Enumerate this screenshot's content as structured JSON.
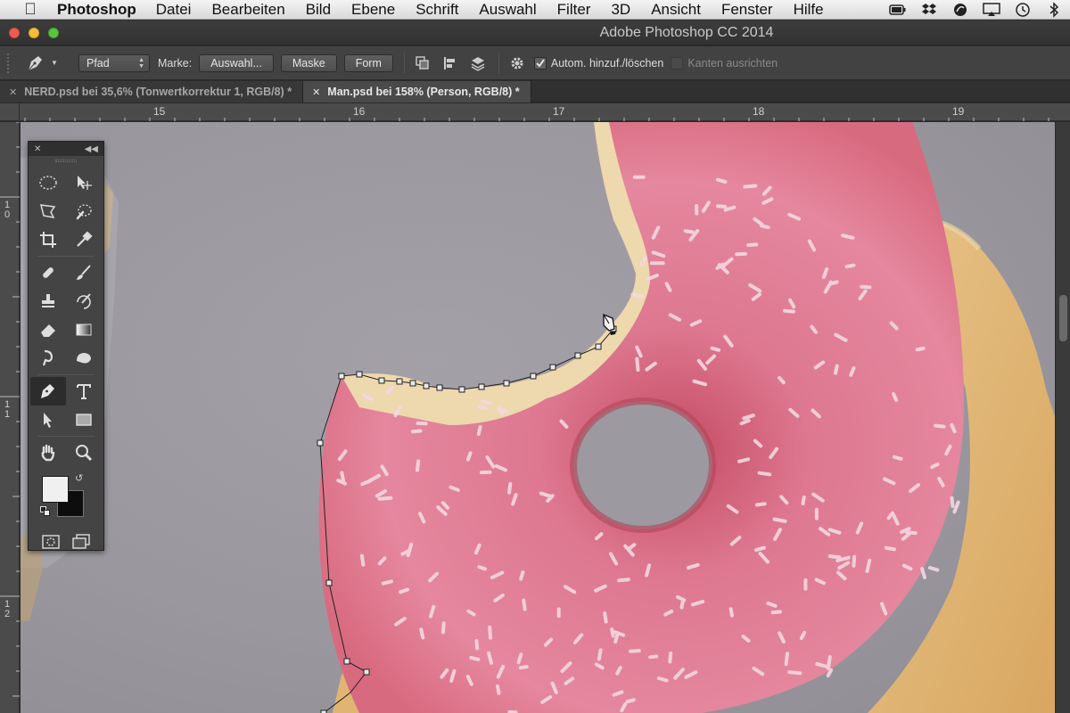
{
  "menubar": {
    "app": "Photoshop",
    "items": [
      "Datei",
      "Bearbeiten",
      "Bild",
      "Ebene",
      "Schrift",
      "Auswahl",
      "Filter",
      "3D",
      "Ansicht",
      "Fenster",
      "Hilfe"
    ],
    "status_icons": [
      "battery-icon",
      "dropbox-icon",
      "cloud-icon",
      "airplay-icon",
      "time-machine-icon",
      "bluetooth-icon"
    ]
  },
  "window": {
    "title": "Adobe Photoshop CC 2014"
  },
  "options": {
    "mode": "Pfad",
    "marke_label": "Marke:",
    "buttons": [
      "Auswahl...",
      "Maske",
      "Form"
    ],
    "auto_add_delete": "Autom. hinzuf./löschen",
    "align_edges": "Kanten ausrichten"
  },
  "tabs": [
    {
      "label": "NERD.psd bei 35,6% (Tonwertkorrektur 1, RGB/8) *",
      "active": false
    },
    {
      "label": "Man.psd bei 158% (Person, RGB/8) *",
      "active": true
    }
  ],
  "ruler": {
    "top": [
      "15",
      "16",
      "17",
      "18",
      "19"
    ],
    "left": [
      [
        "1",
        "0"
      ],
      [
        "1",
        "1"
      ],
      [
        "1",
        "2"
      ]
    ]
  },
  "colors": {
    "accent": "#e98aa0",
    "foreground": "#f0f0f0",
    "background": "#0d0d0d"
  }
}
